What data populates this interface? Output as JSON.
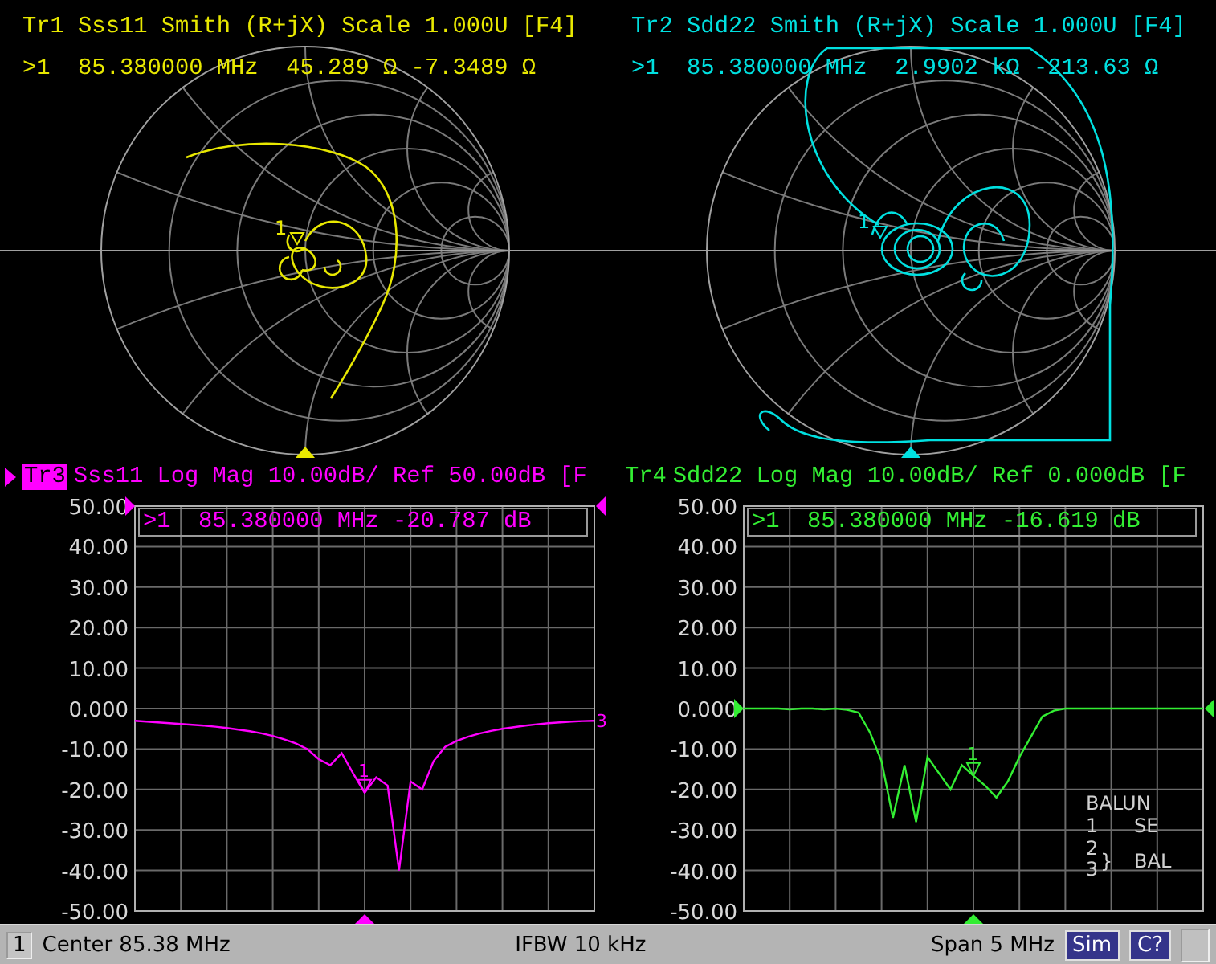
{
  "smith_panels": [
    {
      "header": "Tr1 Sss11 Smith (R+jX) Scale 1.000U [F4]",
      "readout": ">1  85.380000 MHz  45.289 Ω -7.3489 Ω",
      "marker_label": "1",
      "color": "#e8e800"
    },
    {
      "header": "Tr2 Sdd22 Smith (R+jX) Scale 1.000U [F4]",
      "readout": ">1  85.380000 MHz  2.9902 kΩ -213.63 Ω",
      "marker_label": "1",
      "color": "#00e0e0"
    }
  ],
  "logmag_panels": [
    {
      "trace_label": "Tr3",
      "header": "Sss11 Log Mag 10.00dB/ Ref 50.00dB [F",
      "selected": true,
      "color": "#ff00ff",
      "readout": ">1  85.380000 MHz -20.787 dB",
      "end_label": "3",
      "chart_data": {
        "type": "line",
        "ylim": [
          -50,
          50
        ],
        "yticks": [
          {
            "value": 50,
            "label": "50.00"
          },
          {
            "value": 40,
            "label": "40.00"
          },
          {
            "value": 30,
            "label": "30.00"
          },
          {
            "value": 20,
            "label": "20.00"
          },
          {
            "value": 10,
            "label": "10.00"
          },
          {
            "value": 0,
            "label": "0.000"
          },
          {
            "value": -10,
            "label": "-10.00"
          },
          {
            "value": -20,
            "label": "-20.00"
          },
          {
            "value": -30,
            "label": "-30.00"
          },
          {
            "value": -40,
            "label": "-40.00"
          },
          {
            "value": -50,
            "label": "-50.00"
          }
        ],
        "series": [
          {
            "color": "#ff00ff",
            "values": [
              -3,
              -3.2,
              -3.4,
              -3.6,
              -3.8,
              -4,
              -4.2,
              -4.5,
              -4.8,
              -5.2,
              -5.6,
              -6.1,
              -6.8,
              -7.6,
              -8.6,
              -10,
              -12.5,
              -14,
              -11,
              -16,
              -20.8,
              -17,
              -19,
              -40,
              -18,
              -20,
              -13,
              -9.5,
              -8,
              -7,
              -6.2,
              -5.5,
              -5,
              -4.6,
              -4.2,
              -3.9,
              -3.6,
              -3.4,
              -3.2,
              -3.1,
              -3
            ]
          }
        ],
        "grid": true,
        "annotations": [
          "1"
        ]
      }
    },
    {
      "trace_label": "Tr4",
      "header": "Sdd22 Log Mag 10.00dB/ Ref 0.000dB [F",
      "selected": false,
      "color": "#33ee33",
      "readout": ">1  85.380000 MHz -16.619 dB",
      "chart_data": {
        "type": "line",
        "ylim": [
          -50,
          50
        ],
        "yticks": [
          {
            "value": 50,
            "label": "50.00"
          },
          {
            "value": 40,
            "label": "40.00"
          },
          {
            "value": 30,
            "label": "30.00"
          },
          {
            "value": 20,
            "label": "20.00"
          },
          {
            "value": 10,
            "label": "10.00"
          },
          {
            "value": 0,
            "label": "0.000"
          },
          {
            "value": -10,
            "label": "-10.00"
          },
          {
            "value": -20,
            "label": "-20.00"
          },
          {
            "value": -30,
            "label": "-30.00"
          },
          {
            "value": -40,
            "label": "-40.00"
          },
          {
            "value": -50,
            "label": "-50.00"
          }
        ],
        "series": [
          {
            "color": "#33ee33",
            "values": [
              0,
              0,
              0,
              0,
              -0.2,
              0,
              0,
              -0.2,
              0,
              -0.3,
              -1,
              -6,
              -13,
              -27,
              -14,
              -28,
              -12,
              -16,
              -20,
              -14,
              -16.6,
              -19,
              -22,
              -18,
              -12,
              -7,
              -2,
              -0.5,
              0,
              0,
              0,
              0,
              0,
              0,
              0,
              0,
              0,
              0,
              0,
              0,
              0
            ]
          }
        ],
        "grid": true,
        "annotations": [
          "1"
        ]
      },
      "balun": {
        "title": "BALUN",
        "port_1": "1",
        "port_1_type": "SE",
        "port_2": "2",
        "port_3": "3",
        "brace": "}",
        "balanced_type": "BAL"
      }
    }
  ],
  "status_bar": {
    "channel": "1",
    "center": "Center 85.38 MHz",
    "ifbw": "IFBW 10 kHz",
    "span": "Span 5 MHz",
    "indicators": [
      "Sim",
      "C?"
    ]
  }
}
